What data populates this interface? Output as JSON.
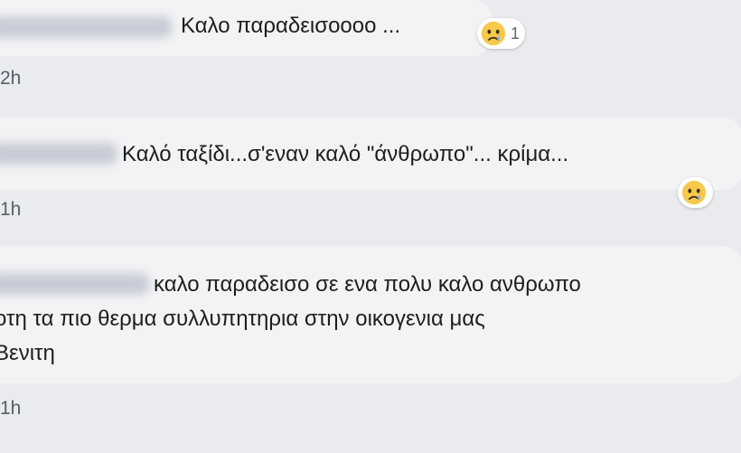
{
  "comments": [
    {
      "text": "Καλο παραδεισοοοο ...",
      "time": "2h",
      "reaction": {
        "icon": "sad-face-icon",
        "count": "1"
      }
    },
    {
      "text": "Καλό ταξίδι...σ'εναν καλό \"άνθρωπο\"... κρίμα...",
      "time": "1h",
      "reaction": {
        "icon": "sad-face-icon",
        "count": ""
      }
    },
    {
      "lines": [
        "καλο παραδεισο σε ενα πολυ καλο ανθρωπο",
        "οτη τα πιο θερμα συλλυπητηρια στην οικογενια μας",
        "Βενιτη"
      ],
      "time": "1h"
    }
  ],
  "colors": {
    "background": "#e9ebee",
    "bubble": "#f2f3f5",
    "text": "#1c1e21",
    "timestamp": "#55606b",
    "reaction_face": "#f7c94b"
  }
}
